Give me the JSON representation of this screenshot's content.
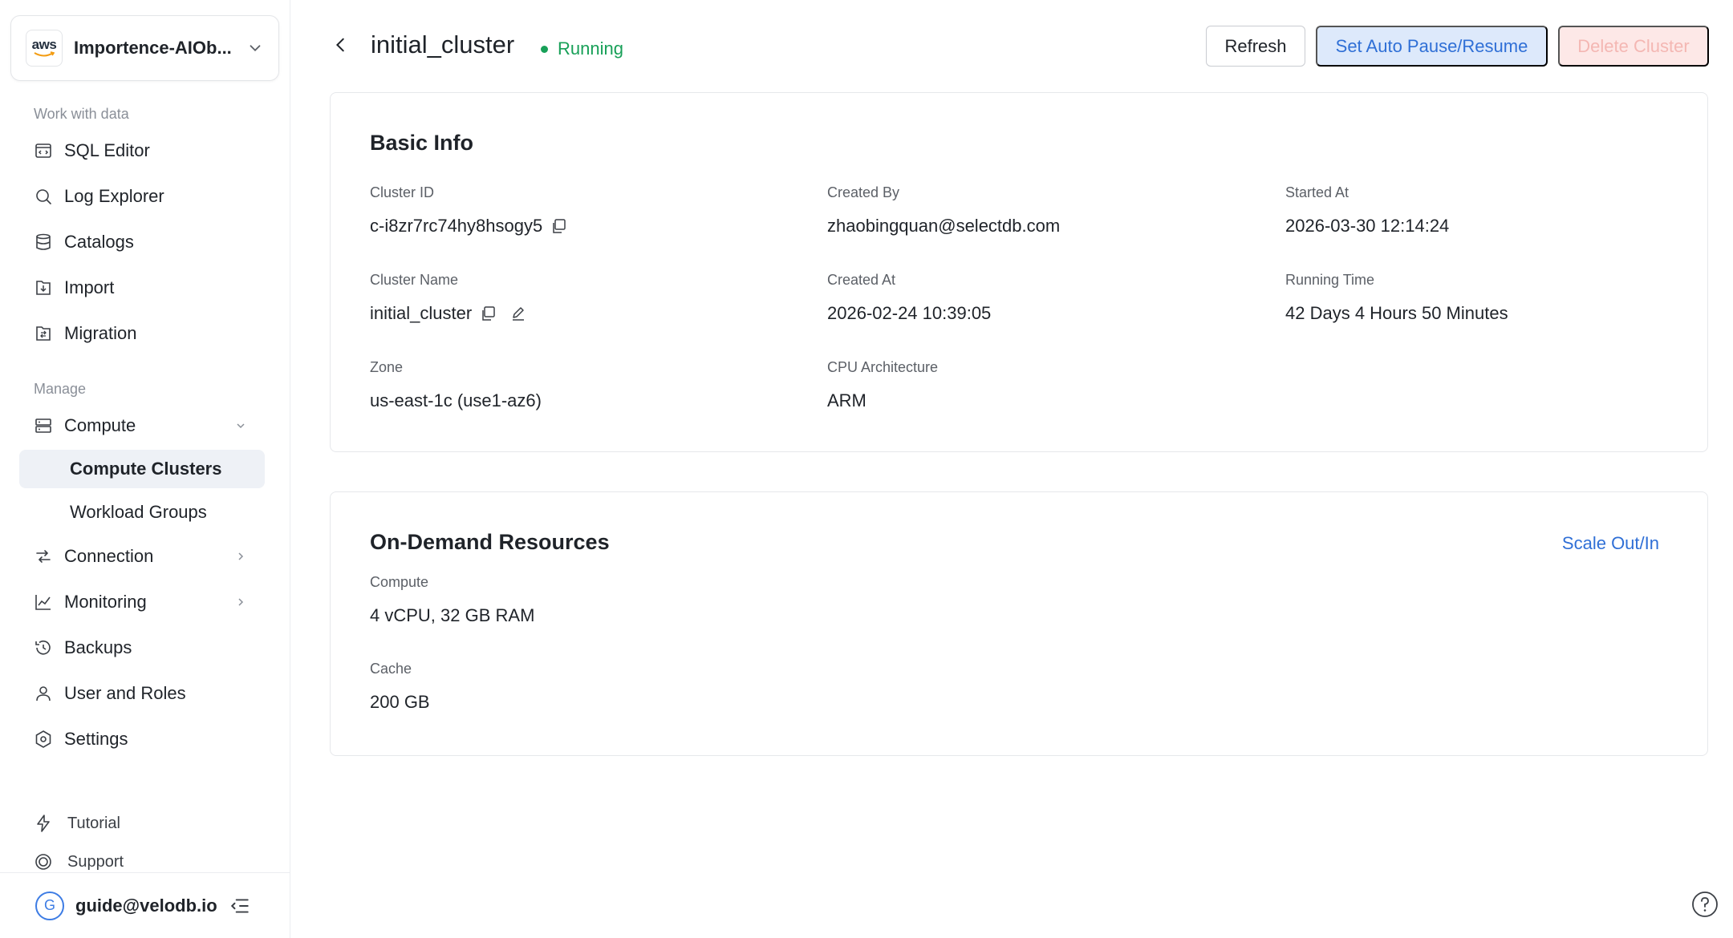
{
  "workspace": {
    "name": "Importence-AIOb...",
    "logo_text": "aws"
  },
  "sidebar": {
    "work_label": "Work with data",
    "work_items": [
      {
        "label": "SQL Editor",
        "icon": "sql-editor-icon"
      },
      {
        "label": "Log Explorer",
        "icon": "search-icon"
      },
      {
        "label": "Catalogs",
        "icon": "database-icon"
      },
      {
        "label": "Import",
        "icon": "import-icon"
      },
      {
        "label": "Migration",
        "icon": "migration-icon"
      }
    ],
    "manage_label": "Manage",
    "compute": {
      "label": "Compute",
      "children": [
        {
          "label": "Compute Clusters",
          "active": true
        },
        {
          "label": "Workload Groups",
          "active": false
        }
      ]
    },
    "manage_items": [
      {
        "label": "Connection",
        "icon": "connection-icon",
        "chevron": "right"
      },
      {
        "label": "Monitoring",
        "icon": "chart-icon",
        "chevron": "right"
      },
      {
        "label": "Backups",
        "icon": "history-icon"
      },
      {
        "label": "User and Roles",
        "icon": "user-icon"
      },
      {
        "label": "Settings",
        "icon": "gear-icon"
      }
    ],
    "bottom": [
      {
        "label": "Tutorial",
        "icon": "bolt-icon"
      },
      {
        "label": "Support",
        "icon": "lifebuoy-icon"
      }
    ],
    "user": {
      "initial": "G",
      "email": "guide@velodb.io"
    }
  },
  "header": {
    "title": "initial_cluster",
    "status": "Running",
    "refresh_label": "Refresh",
    "auto_label": "Set Auto Pause/Resume",
    "delete_label": "Delete Cluster"
  },
  "basic_info": {
    "title": "Basic Info",
    "cluster_id_label": "Cluster ID",
    "cluster_id": "c-i8zr7rc74hy8hsogy5",
    "created_by_label": "Created By",
    "created_by": "zhaobingquan@selectdb.com",
    "started_at_label": "Started At",
    "started_at": "2026-03-30 12:14:24",
    "cluster_name_label": "Cluster Name",
    "cluster_name": "initial_cluster",
    "created_at_label": "Created At",
    "created_at": "2026-02-24 10:39:05",
    "running_time_label": "Running Time",
    "running_time": "42 Days 4 Hours 50 Minutes",
    "zone_label": "Zone",
    "zone": "us-east-1c (use1-az6)",
    "cpu_arch_label": "CPU Architecture",
    "cpu_arch": "ARM"
  },
  "on_demand": {
    "title": "On-Demand Resources",
    "scale_label": "Scale Out/In",
    "compute_label": "Compute",
    "compute": "4 vCPU, 32 GB RAM",
    "cache_label": "Cache",
    "cache": "200 GB"
  },
  "colors": {
    "accent": "#2f6fd6",
    "running": "#18a058",
    "danger_bg": "#fde8e7"
  }
}
